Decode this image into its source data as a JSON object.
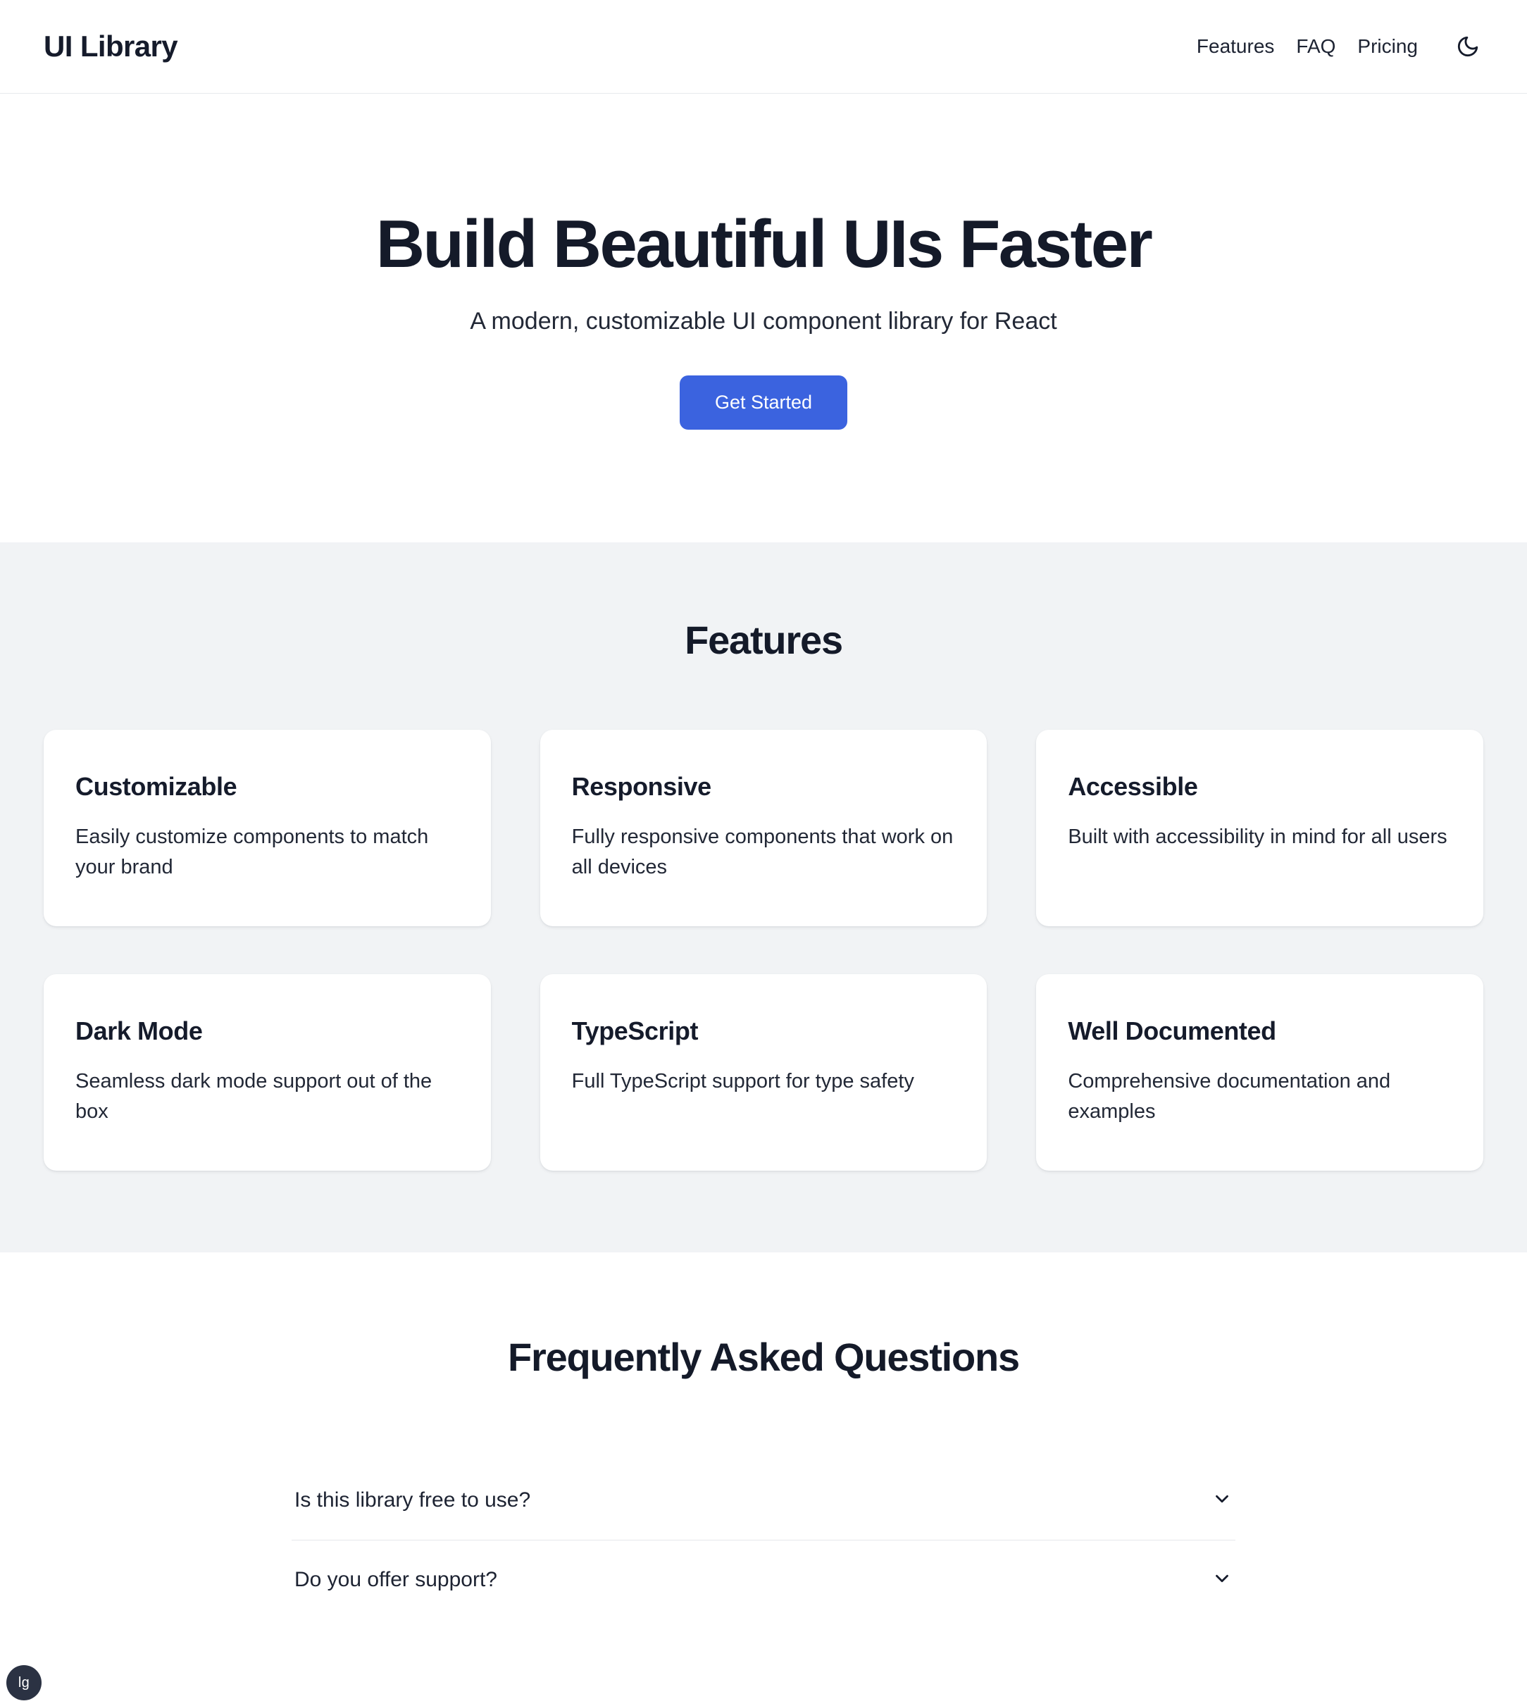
{
  "header": {
    "brand": "UI Library",
    "nav": [
      {
        "label": "Features"
      },
      {
        "label": "FAQ"
      },
      {
        "label": "Pricing"
      }
    ],
    "theme_toggle_icon": "moon-icon"
  },
  "hero": {
    "title": "Build Beautiful UIs Faster",
    "subtitle": "A modern, customizable UI component library for React",
    "cta_label": "Get Started",
    "cta_color": "#3b63df"
  },
  "features": {
    "title": "Features",
    "background": "#f1f3f5",
    "cards": [
      {
        "title": "Customizable",
        "desc": "Easily customize components to match your brand"
      },
      {
        "title": "Responsive",
        "desc": "Fully responsive components that work on all devices"
      },
      {
        "title": "Accessible",
        "desc": "Built with accessibility in mind for all users"
      },
      {
        "title": "Dark Mode",
        "desc": "Seamless dark mode support out of the box"
      },
      {
        "title": "TypeScript",
        "desc": "Full TypeScript support for type safety"
      },
      {
        "title": "Well Documented",
        "desc": "Comprehensive documentation and examples"
      }
    ]
  },
  "faq": {
    "title": "Frequently Asked Questions",
    "items": [
      {
        "question": "Is this library free to use?",
        "icon": "chevron-down-icon"
      },
      {
        "question": "Do you offer support?",
        "icon": "chevron-down-icon"
      }
    ]
  },
  "badge": {
    "label": "lg"
  }
}
